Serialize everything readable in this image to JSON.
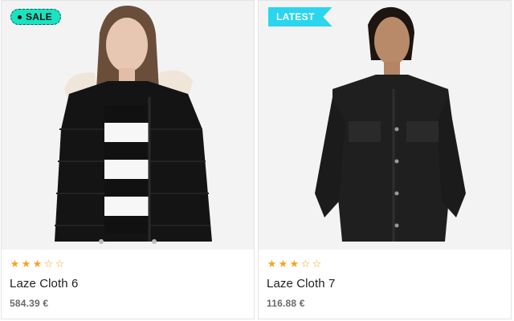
{
  "products": [
    {
      "badge": "SALE",
      "badge_type": "sale",
      "rating": 3,
      "rating_max": 5,
      "name": "Laze Cloth 6",
      "price": "584.39 €"
    },
    {
      "badge": "LATEST",
      "badge_type": "latest",
      "rating": 3,
      "rating_max": 5,
      "name": "Laze Cloth 7",
      "price": "116.88 €"
    }
  ],
  "icons": {
    "star_full": "star-filled-icon",
    "star_empty": "star-outline-icon"
  },
  "colors": {
    "sale_badge": "#19e3c1",
    "latest_badge": "#29d6ee",
    "star": "#f5a524"
  }
}
